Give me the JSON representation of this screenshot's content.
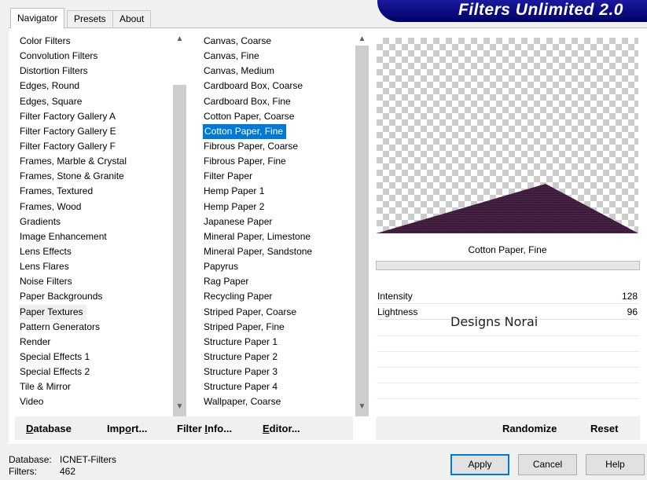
{
  "banner": {
    "title": "Filters Unlimited 2.0"
  },
  "tabs": [
    {
      "label": "Navigator",
      "active": true
    },
    {
      "label": "Presets",
      "active": false
    },
    {
      "label": "About",
      "active": false
    }
  ],
  "categories": [
    "Color Filters",
    "Convolution Filters",
    "Distortion Filters",
    "Edges, Round",
    "Edges, Square",
    "Filter Factory Gallery A",
    "Filter Factory Gallery E",
    "Filter Factory Gallery F",
    "Frames, Marble & Crystal",
    "Frames, Stone & Granite",
    "Frames, Textured",
    "Frames, Wood",
    "Gradients",
    "Image Enhancement",
    "Lens Effects",
    "Lens Flares",
    "Noise Filters",
    "Paper Backgrounds",
    "Paper Textures",
    "Pattern Generators",
    "Render",
    "Special Effects 1",
    "Special Effects 2",
    "Tile & Mirror",
    "Video"
  ],
  "categories_selected_index": 18,
  "filters": [
    "Canvas, Coarse",
    "Canvas, Fine",
    "Canvas, Medium",
    "Cardboard Box, Coarse",
    "Cardboard Box, Fine",
    "Cotton Paper, Coarse",
    "Cotton Paper, Fine",
    "Fibrous Paper, Coarse",
    "Fibrous Paper, Fine",
    "Filter Paper",
    "Hemp Paper 1",
    "Hemp Paper 2",
    "Japanese Paper",
    "Mineral Paper, Limestone",
    "Mineral Paper, Sandstone",
    "Papyrus",
    "Rag Paper",
    "Recycling Paper",
    "Striped Paper, Coarse",
    "Striped Paper, Fine",
    "Structure Paper 1",
    "Structure Paper 2",
    "Structure Paper 3",
    "Structure Paper 4",
    "Wallpaper, Coarse"
  ],
  "filters_selected_index": 6,
  "preview": {
    "filter_name": "Cotton Paper, Fine",
    "shape_color": "#3a1a38",
    "checker_color": "#cccccc"
  },
  "progress": {
    "value": 0
  },
  "params": [
    {
      "label": "Intensity",
      "value": "128"
    },
    {
      "label": "Lightness",
      "value": "96"
    }
  ],
  "watermark": "Designs Norai",
  "left_buttons": [
    {
      "pre": "",
      "u": "D",
      "post": "atabase"
    },
    {
      "pre": "Imp",
      "u": "o",
      "post": "rt..."
    },
    {
      "pre": "Filter ",
      "u": "I",
      "post": "nfo..."
    },
    {
      "pre": "",
      "u": "E",
      "post": "ditor..."
    }
  ],
  "right_buttons": {
    "randomize": "Randomize",
    "reset": "Reset"
  },
  "status": {
    "database_label": "Database:",
    "database_value": "ICNET-Filters",
    "filters_label": "Filters:",
    "filters_value": "462"
  },
  "dialog_buttons": {
    "apply": "Apply",
    "cancel": "Cancel",
    "help": "Help"
  },
  "colors": {
    "banner": "#000066",
    "selection": "#0078d7",
    "scroll_thumb": "#cdcdcd"
  }
}
